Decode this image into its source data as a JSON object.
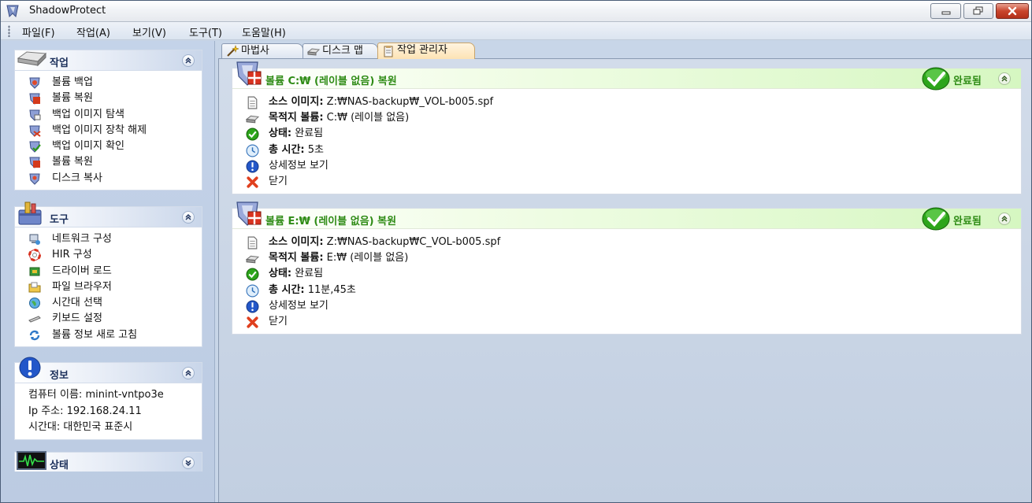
{
  "window": {
    "title": "ShadowProtect"
  },
  "menu": [
    "파일(F)",
    "작업(A)",
    "보기(V)",
    "도구(T)",
    "도움말(H)"
  ],
  "panels": {
    "tasks": {
      "title": "작업",
      "items": [
        "볼륨 백업",
        "볼륨 복원",
        "백업 이미지 탐색",
        "백업 이미지 장착 해제",
        "백업 이미지 확인",
        "볼륨 복원",
        "디스크 복사"
      ]
    },
    "tools": {
      "title": "도구",
      "items": [
        "네트워크 구성",
        "HIR 구성",
        "드라이버 로드",
        "파일 브라우저",
        "시간대 선택",
        "키보드 설정",
        "볼륨 정보 새로 고침"
      ]
    },
    "info": {
      "title": "정보",
      "lines": [
        "컴퓨터 이름: minint-vntpo3e",
        "Ip 주소: 192.168.24.11",
        "시간대: 대한민국 표준시"
      ]
    },
    "status": {
      "title": "상태"
    }
  },
  "tabs": [
    "마법사",
    "디스크 맵",
    "작업 관리자"
  ],
  "jobs": [
    {
      "title": "볼륨 C:₩ (레이블 없음) 복원",
      "status": "완료됨",
      "source_label": "소스 이미지:",
      "source_value": "Z:₩NAS-backup₩_VOL-b005.spf",
      "target_label": "목적지 볼륨:",
      "target_value": "C:₩ (레이블 없음)",
      "state_label": "상태:",
      "state_value": "완료됨",
      "time_label": "총 시간:",
      "time_value": "5초",
      "details": "상세정보 보기",
      "close": "닫기"
    },
    {
      "title": "볼륨 E:₩ (레이블 없음) 복원",
      "status": "완료됨",
      "source_label": "소스 이미지:",
      "source_value": "Z:₩NAS-backup₩C_VOL-b005.spf",
      "target_label": "목적지 볼륨:",
      "target_value": "E:₩ (레이블 없음)",
      "state_label": "상태:",
      "state_value": "완료됨",
      "time_label": "총 시간:",
      "time_value": "11분,45초",
      "details": "상세정보 보기",
      "close": "닫기"
    }
  ],
  "colors": {
    "accent_green": "#2e8b15",
    "panel_title": "#1b2f5a",
    "close_red": "#c9452c"
  }
}
